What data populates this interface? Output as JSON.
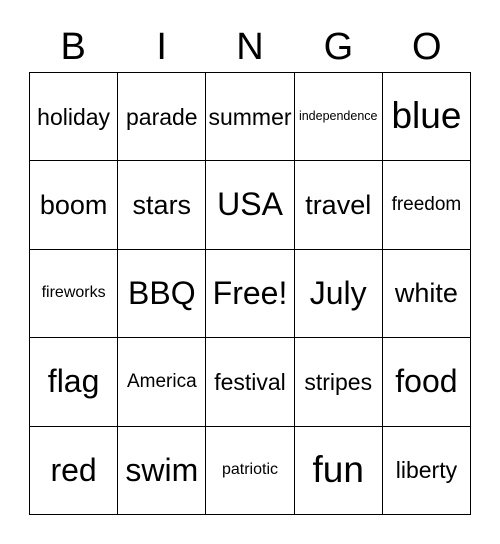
{
  "card": {
    "title": "BINGO",
    "header_letters": [
      "B",
      "I",
      "N",
      "G",
      "O"
    ],
    "free_space_label": "Free!",
    "grid": {
      "columns": 5,
      "rows": 5,
      "cells": [
        [
          {
            "text": "holiday",
            "size": "m"
          },
          {
            "text": "parade",
            "size": "m"
          },
          {
            "text": "summer",
            "size": "m"
          },
          {
            "text": "independence",
            "size": "xxs"
          },
          {
            "text": "blue",
            "size": "xxl"
          }
        ],
        [
          {
            "text": "boom",
            "size": "l"
          },
          {
            "text": "stars",
            "size": "l"
          },
          {
            "text": "USA",
            "size": "xl"
          },
          {
            "text": "travel",
            "size": "l"
          },
          {
            "text": "freedom",
            "size": "s"
          }
        ],
        [
          {
            "text": "fireworks",
            "size": "xs"
          },
          {
            "text": "BBQ",
            "size": "xl"
          },
          {
            "text": "Free!",
            "size": "xl"
          },
          {
            "text": "July",
            "size": "xl"
          },
          {
            "text": "white",
            "size": "l"
          }
        ],
        [
          {
            "text": "flag",
            "size": "xl"
          },
          {
            "text": "America",
            "size": "s"
          },
          {
            "text": "festival",
            "size": "m"
          },
          {
            "text": "stripes",
            "size": "m"
          },
          {
            "text": "food",
            "size": "xl"
          }
        ],
        [
          {
            "text": "red",
            "size": "xl"
          },
          {
            "text": "swim",
            "size": "xl"
          },
          {
            "text": "patriotic",
            "size": "xs"
          },
          {
            "text": "fun",
            "size": "xxl"
          },
          {
            "text": "liberty",
            "size": "m"
          }
        ]
      ]
    },
    "colors": {
      "background": "#ffffff",
      "border": "#000000",
      "text": "#000000"
    }
  }
}
